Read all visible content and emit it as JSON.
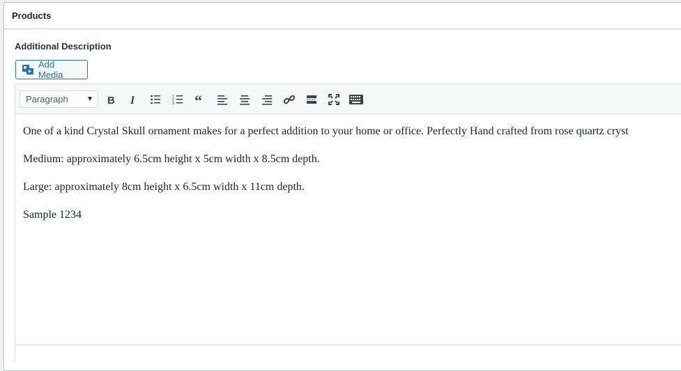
{
  "panel": {
    "title": "Products"
  },
  "field": {
    "label": "Additional Description"
  },
  "media": {
    "add_label": "Add Media"
  },
  "toolbar": {
    "format_value": "Paragraph",
    "buttons": [
      {
        "name": "bold-button",
        "icon": "bold-icon"
      },
      {
        "name": "italic-button",
        "icon": "italic-icon"
      },
      {
        "name": "bulleted-list-button",
        "icon": "bulleted-list-icon"
      },
      {
        "name": "numbered-list-button",
        "icon": "numbered-list-icon"
      },
      {
        "name": "blockquote-button",
        "icon": "blockquote-icon"
      },
      {
        "name": "align-left-button",
        "icon": "align-left-icon"
      },
      {
        "name": "align-center-button",
        "icon": "align-center-icon"
      },
      {
        "name": "align-right-button",
        "icon": "align-right-icon"
      },
      {
        "name": "insert-link-button",
        "icon": "link-icon"
      },
      {
        "name": "read-more-button",
        "icon": "read-more-icon"
      },
      {
        "name": "fullscreen-button",
        "icon": "fullscreen-icon"
      },
      {
        "name": "toolbar-toggle-button",
        "icon": "keyboard-icon"
      }
    ]
  },
  "editor": {
    "paragraphs": [
      "One of a kind Crystal Skull ornament makes for a perfect addition to your home or office. Perfectly Hand crafted from rose quartz cryst",
      "Medium: approximately 6.5cm height x 5cm width x 8.5cm depth.",
      "Large: approximately 8cm height x 6.5cm width x 11cm depth.",
      "Sample 1234"
    ]
  },
  "colors": {
    "accent": "#2271b1",
    "border": "#c3c4c7",
    "toolbar_bg": "#f6f7f7"
  }
}
